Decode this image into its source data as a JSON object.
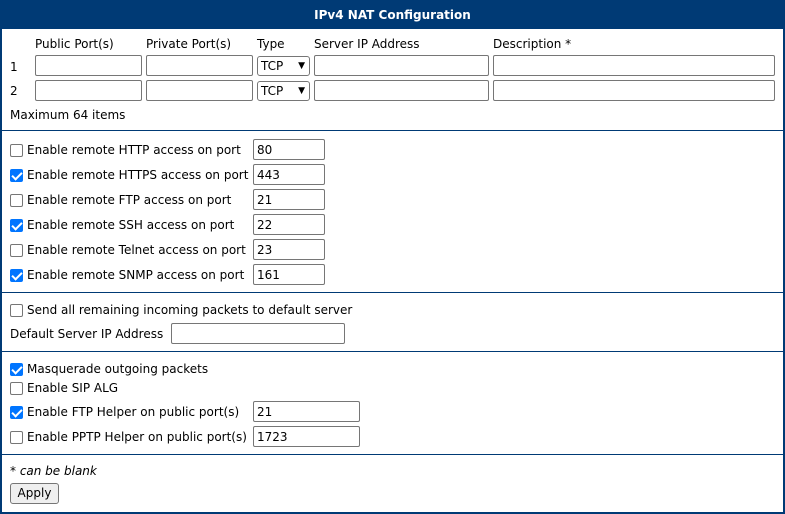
{
  "title": "IPv4 NAT Configuration",
  "table": {
    "headers": [
      "Public Port(s)",
      "Private Port(s)",
      "Type",
      "Server IP Address",
      "Description *"
    ],
    "rows": [
      {
        "index": "1",
        "public": "",
        "private": "",
        "type": "TCP",
        "server_ip": "",
        "description": ""
      },
      {
        "index": "2",
        "public": "",
        "private": "",
        "type": "TCP",
        "server_ip": "",
        "description": ""
      }
    ],
    "note": "Maximum 64 items"
  },
  "remote_access": [
    {
      "label": "Enable remote HTTP access on port",
      "checked": false,
      "port": "80"
    },
    {
      "label": "Enable remote HTTPS access on port",
      "checked": true,
      "port": "443"
    },
    {
      "label": "Enable remote FTP access on port",
      "checked": false,
      "port": "21"
    },
    {
      "label": "Enable remote SSH access on port",
      "checked": true,
      "port": "22"
    },
    {
      "label": "Enable remote Telnet access on port",
      "checked": false,
      "port": "23"
    },
    {
      "label": "Enable remote SNMP access on port",
      "checked": true,
      "port": "161"
    }
  ],
  "default_server": {
    "send_label": "Send all remaining incoming packets to default server",
    "send_checked": false,
    "ip_label": "Default Server IP Address",
    "ip_value": ""
  },
  "advanced": {
    "masquerade": {
      "label": "Masquerade outgoing packets",
      "checked": true
    },
    "sip_alg": {
      "label": "Enable SIP ALG",
      "checked": false
    },
    "ftp_helper": {
      "label": "Enable FTP Helper on public port(s)",
      "checked": true,
      "value": "21"
    },
    "pptp_helper": {
      "label": "Enable PPTP Helper on public port(s)",
      "checked": false,
      "value": "1723"
    }
  },
  "footer": {
    "note": "* can be blank",
    "apply_label": "Apply"
  },
  "colors": {
    "header_bg": "#003a75",
    "checkbox_checked": "#0075ff"
  }
}
